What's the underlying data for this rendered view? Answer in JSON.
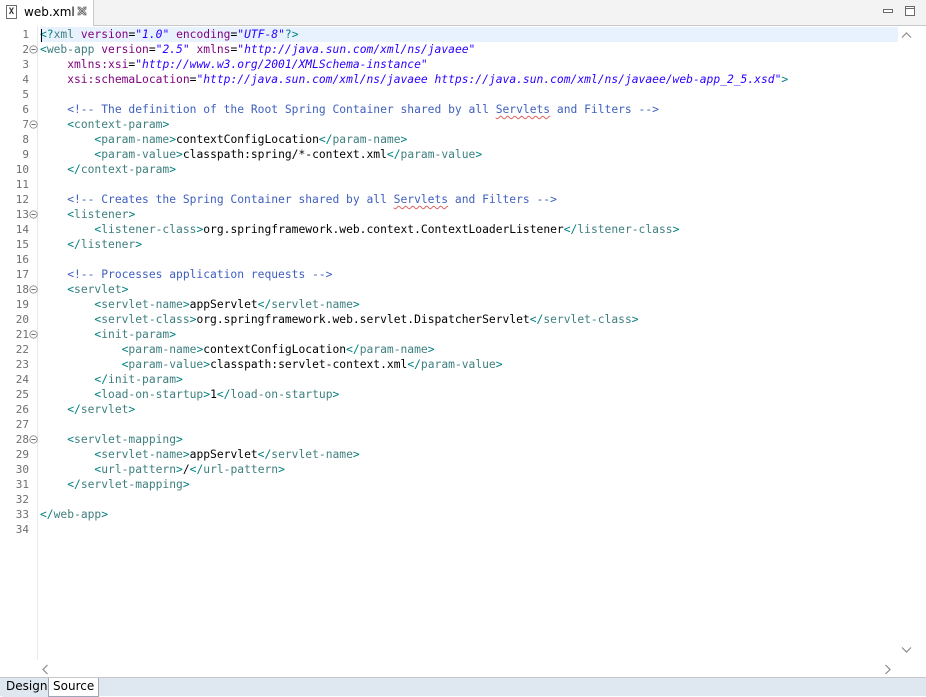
{
  "tab": {
    "title": "web.xml",
    "file_icon": "xml-file-icon",
    "file_icon_glyph": "X"
  },
  "window_controls": {
    "minimize": "minimize-icon",
    "maximize": "maximize-icon"
  },
  "editor": {
    "lines": [
      [
        [
          "b",
          "<?"
        ],
        [
          "t",
          "xml"
        ],
        [
          "a",
          " version"
        ],
        [
          "x",
          "="
        ],
        [
          "v",
          "\"1.0\""
        ],
        [
          "a",
          " encoding"
        ],
        [
          "x",
          "="
        ],
        [
          "v",
          "\"UTF-8\""
        ],
        [
          "b",
          "?>"
        ]
      ],
      [
        [
          "b",
          "<"
        ],
        [
          "t",
          "web-app"
        ],
        [
          "a",
          " version"
        ],
        [
          "x",
          "="
        ],
        [
          "v",
          "\"2.5\""
        ],
        [
          "a",
          " xmlns"
        ],
        [
          "x",
          "="
        ],
        [
          "v",
          "\"http://java.sun.com/xml/ns/javaee\""
        ]
      ],
      [
        [
          "a",
          "    xmlns:xsi"
        ],
        [
          "x",
          "="
        ],
        [
          "v",
          "\"http://www.w3.org/2001/XMLSchema-instance\""
        ]
      ],
      [
        [
          "a",
          "    xsi:schemaLocation"
        ],
        [
          "x",
          "="
        ],
        [
          "v",
          "\"http://java.sun.com/xml/ns/javaee https://java.sun.com/xml/ns/javaee/web-app_2_5.xsd\""
        ],
        [
          "b",
          ">"
        ]
      ],
      [],
      [
        [
          "c",
          "    <!-- The definition of the Root Spring Container shared by all "
        ],
        [
          "cs",
          "Servlets"
        ],
        [
          "c",
          " and Filters -->"
        ]
      ],
      [
        [
          "b",
          "    <"
        ],
        [
          "t",
          "context-param"
        ],
        [
          "b",
          ">"
        ]
      ],
      [
        [
          "b",
          "        <"
        ],
        [
          "t",
          "param-name"
        ],
        [
          "b",
          ">"
        ],
        [
          "x",
          "contextConfigLocation"
        ],
        [
          "b",
          "</"
        ],
        [
          "t",
          "param-name"
        ],
        [
          "b",
          ">"
        ]
      ],
      [
        [
          "b",
          "        <"
        ],
        [
          "t",
          "param-value"
        ],
        [
          "b",
          ">"
        ],
        [
          "x",
          "classpath:spring/*-context.xml"
        ],
        [
          "b",
          "</"
        ],
        [
          "t",
          "param-value"
        ],
        [
          "b",
          ">"
        ]
      ],
      [
        [
          "b",
          "    </"
        ],
        [
          "t",
          "context-param"
        ],
        [
          "b",
          ">"
        ]
      ],
      [],
      [
        [
          "c",
          "    <!-- Creates the Spring Container shared by all "
        ],
        [
          "cs",
          "Servlets"
        ],
        [
          "c",
          " and Filters -->"
        ]
      ],
      [
        [
          "b",
          "    <"
        ],
        [
          "t",
          "listener"
        ],
        [
          "b",
          ">"
        ]
      ],
      [
        [
          "b",
          "        <"
        ],
        [
          "t",
          "listener-class"
        ],
        [
          "b",
          ">"
        ],
        [
          "x",
          "org.springframework.web.context.ContextLoaderListener"
        ],
        [
          "b",
          "</"
        ],
        [
          "t",
          "listener-class"
        ],
        [
          "b",
          ">"
        ]
      ],
      [
        [
          "b",
          "    </"
        ],
        [
          "t",
          "listener"
        ],
        [
          "b",
          ">"
        ]
      ],
      [],
      [
        [
          "c",
          "    <!-- Processes application requests -->"
        ]
      ],
      [
        [
          "b",
          "    <"
        ],
        [
          "t",
          "servlet"
        ],
        [
          "b",
          ">"
        ]
      ],
      [
        [
          "b",
          "        <"
        ],
        [
          "t",
          "servlet-name"
        ],
        [
          "b",
          ">"
        ],
        [
          "x",
          "appServlet"
        ],
        [
          "b",
          "</"
        ],
        [
          "t",
          "servlet-name"
        ],
        [
          "b",
          ">"
        ]
      ],
      [
        [
          "b",
          "        <"
        ],
        [
          "t",
          "servlet-class"
        ],
        [
          "b",
          ">"
        ],
        [
          "x",
          "org.springframework.web.servlet.DispatcherServlet"
        ],
        [
          "b",
          "</"
        ],
        [
          "t",
          "servlet-class"
        ],
        [
          "b",
          ">"
        ]
      ],
      [
        [
          "b",
          "        <"
        ],
        [
          "t",
          "init-param"
        ],
        [
          "b",
          ">"
        ]
      ],
      [
        [
          "b",
          "            <"
        ],
        [
          "t",
          "param-name"
        ],
        [
          "b",
          ">"
        ],
        [
          "x",
          "contextConfigLocation"
        ],
        [
          "b",
          "</"
        ],
        [
          "t",
          "param-name"
        ],
        [
          "b",
          ">"
        ]
      ],
      [
        [
          "b",
          "            <"
        ],
        [
          "t",
          "param-value"
        ],
        [
          "b",
          ">"
        ],
        [
          "x",
          "classpath:servlet-context.xml"
        ],
        [
          "b",
          "</"
        ],
        [
          "t",
          "param-value"
        ],
        [
          "b",
          ">"
        ]
      ],
      [
        [
          "b",
          "        </"
        ],
        [
          "t",
          "init-param"
        ],
        [
          "b",
          ">"
        ]
      ],
      [
        [
          "b",
          "        <"
        ],
        [
          "t",
          "load-on-startup"
        ],
        [
          "b",
          ">"
        ],
        [
          "x",
          "1"
        ],
        [
          "b",
          "</"
        ],
        [
          "t",
          "load-on-startup"
        ],
        [
          "b",
          ">"
        ]
      ],
      [
        [
          "b",
          "    </"
        ],
        [
          "t",
          "servlet"
        ],
        [
          "b",
          ">"
        ]
      ],
      [],
      [
        [
          "b",
          "    <"
        ],
        [
          "t",
          "servlet-mapping"
        ],
        [
          "b",
          ">"
        ]
      ],
      [
        [
          "b",
          "        <"
        ],
        [
          "t",
          "servlet-name"
        ],
        [
          "b",
          ">"
        ],
        [
          "x",
          "appServlet"
        ],
        [
          "b",
          "</"
        ],
        [
          "t",
          "servlet-name"
        ],
        [
          "b",
          ">"
        ]
      ],
      [
        [
          "b",
          "        <"
        ],
        [
          "t",
          "url-pattern"
        ],
        [
          "b",
          ">"
        ],
        [
          "x",
          "/"
        ],
        [
          "b",
          "</"
        ],
        [
          "t",
          "url-pattern"
        ],
        [
          "b",
          ">"
        ]
      ],
      [
        [
          "b",
          "    </"
        ],
        [
          "t",
          "servlet-mapping"
        ],
        [
          "b",
          ">"
        ]
      ],
      [],
      [
        [
          "b",
          "</"
        ],
        [
          "t",
          "web-app"
        ],
        [
          "b",
          ">"
        ]
      ],
      []
    ],
    "fold_lines": [
      2,
      7,
      13,
      18,
      21,
      28
    ],
    "current_line": 1,
    "colors": {
      "bracket": "#008080",
      "tag": "#3f7f7f",
      "attribute": "#7f007f",
      "value": "#2a00ff",
      "comment": "#3f5fbf",
      "text": "#000000",
      "current_line_highlight": "#e8f2fe"
    }
  },
  "bottom_tabs": [
    {
      "label": "Design",
      "active": false
    },
    {
      "label": "Source",
      "active": true
    }
  ]
}
